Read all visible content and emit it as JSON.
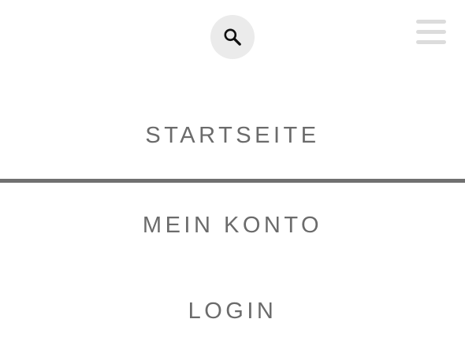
{
  "header": {
    "search_icon": "search-icon",
    "menu_icon": "hamburger-menu-icon"
  },
  "menu": {
    "items": [
      {
        "label": "STARTSEITE"
      },
      {
        "label": "MEIN KONTO"
      },
      {
        "label": "LOGIN"
      }
    ]
  },
  "colors": {
    "text": "#6b6b6b",
    "divider": "#707070",
    "search_bg": "#ebebeb",
    "hamburger": "#dcdcdc"
  }
}
